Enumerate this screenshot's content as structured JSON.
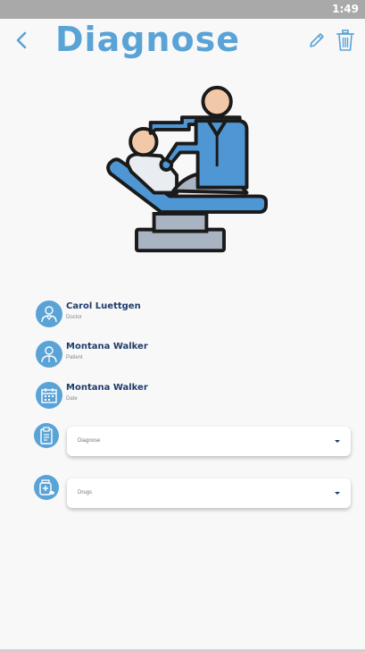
{
  "status_bar": {
    "time": "1:49"
  },
  "header": {
    "title": "Diagnose"
  },
  "info": [
    {
      "name": "Carol Luettgen",
      "role": "Doctor"
    },
    {
      "name": "Montana Walker",
      "role": "Patient"
    },
    {
      "name": "Montana Walker",
      "role": "Date"
    }
  ],
  "fields": {
    "diagnose": {
      "placeholder": "Diagnose"
    },
    "drugs": {
      "placeholder": "Drugs"
    }
  },
  "colors": {
    "accent": "#5aa3d6",
    "name_text": "#1d3b6b",
    "background": "#f8f8f8",
    "status_bar": "#a9a9a9"
  }
}
